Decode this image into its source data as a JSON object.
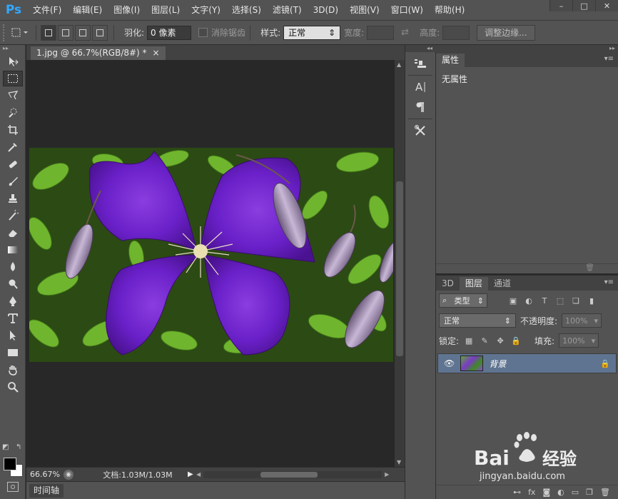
{
  "app": {
    "logo": "Ps"
  },
  "menu": [
    "文件(F)",
    "编辑(E)",
    "图像(I)",
    "图层(L)",
    "文字(Y)",
    "选择(S)",
    "滤镜(T)",
    "3D(D)",
    "视图(V)",
    "窗口(W)",
    "帮助(H)"
  ],
  "window_controls": {
    "minimize": "–",
    "restore": "□",
    "close": "✕"
  },
  "options": {
    "feather_label": "羽化:",
    "feather_value": "0 像素",
    "antialias_label": "消除锯齿",
    "style_label": "样式:",
    "style_value": "正常",
    "width_label": "宽度:",
    "height_label": "高度:",
    "refine_button": "调整边缘..."
  },
  "document": {
    "tab_title": "1.jpg @ 66.7%(RGB/8#) *",
    "tab_close": "×",
    "zoom": "66.67%",
    "doc_info": "文档:1.03M/1.03M"
  },
  "timeline": {
    "label": "时间轴"
  },
  "properties": {
    "tab": "属性",
    "body": "无属性"
  },
  "layers": {
    "tabs": [
      "3D",
      "图层",
      "通道"
    ],
    "filter_label": "类型",
    "blend_mode": "正常",
    "opacity_label": "不透明度:",
    "opacity_value": "100%",
    "lock_label": "锁定:",
    "fill_label": "填充:",
    "fill_value": "100%",
    "layer_name": "背景"
  },
  "watermark": {
    "brand": "Bai",
    "brand_tail": "经验",
    "url": "jingyan.baidu.com"
  },
  "colors": {
    "accent": "#31a8ff",
    "panel": "#535353",
    "canvas": "#282828",
    "selected_layer": "#5f7490"
  }
}
